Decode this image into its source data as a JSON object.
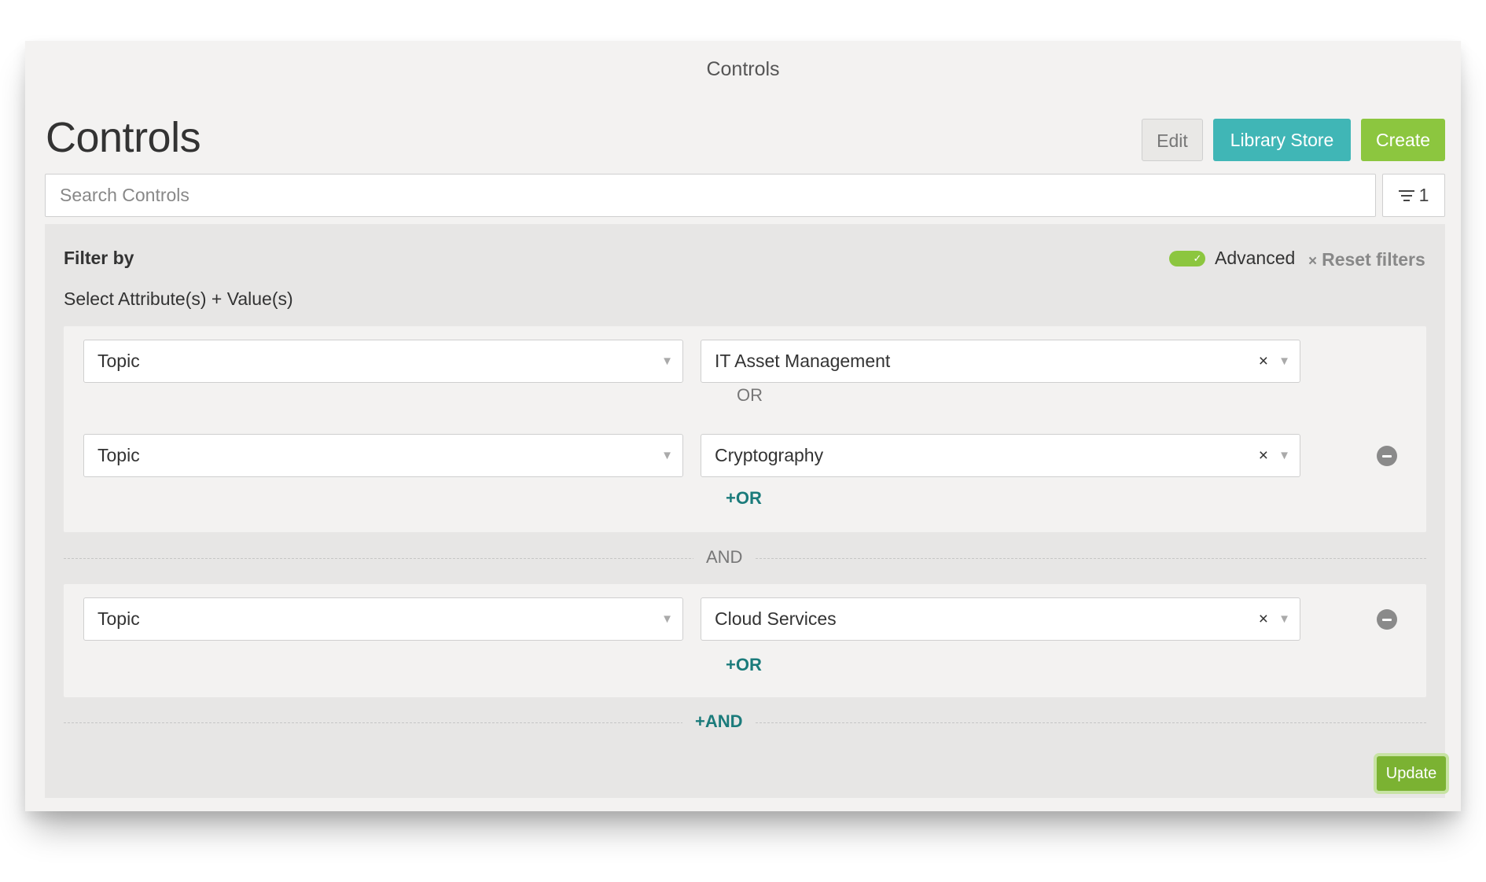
{
  "window": {
    "title": "Controls"
  },
  "header": {
    "title": "Controls",
    "edit_label": "Edit",
    "library_label": "Library Store",
    "create_label": "Create"
  },
  "search": {
    "placeholder": "Search Controls",
    "value": ""
  },
  "filter_button": {
    "count": "1"
  },
  "filter_panel": {
    "title": "Filter by",
    "subtitle": "Select Attribute(s) + Value(s)",
    "advanced_label": "Advanced",
    "advanced_enabled": true,
    "reset_label": "Reset filters",
    "and_label": "AND",
    "add_and_label": "+AND",
    "update_label": "Update",
    "groups": [
      {
        "conditions": [
          {
            "attribute": "Topic",
            "value": "IT Asset Management"
          },
          {
            "attribute": "Topic",
            "value": "Cryptography"
          }
        ],
        "or_label": "OR",
        "add_or_label": "+OR"
      },
      {
        "conditions": [
          {
            "attribute": "Topic",
            "value": "Cloud Services"
          }
        ],
        "add_or_label": "+OR"
      }
    ]
  },
  "colors": {
    "teal": "#40b6b6",
    "green": "#8cc63f",
    "link_teal": "#1b7b7b"
  }
}
